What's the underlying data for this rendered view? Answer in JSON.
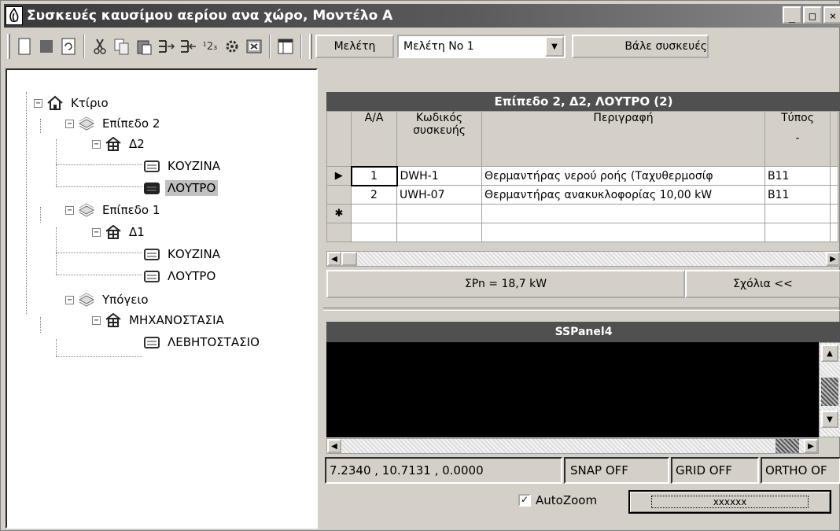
{
  "window": {
    "title": "Συσκευές καυσίμου αερίου ανα χώρο,  Μοντέλο Α",
    "min_glyph": "_",
    "max_glyph": "□",
    "close_glyph": "×"
  },
  "toolbar": {
    "study_button": "Μελέτη",
    "study_select_value": "Μελέτη No 1",
    "place_devices_button": "Βάλε συσκευές",
    "number_format_icon_text": "¹2₃",
    "icons": [
      "new-icon",
      "stop-icon",
      "refresh-icon",
      "cut-icon",
      "copy-icon",
      "paste-icon",
      "insert-right-icon",
      "insert-left-icon",
      "number-format-icon",
      "tree-gear-icon",
      "excel-icon",
      "columns-icon"
    ]
  },
  "tree": {
    "root": "Κτίριο",
    "level2": "Επίπεδο 2",
    "d2": "Δ2",
    "kitchen2": "ΚΟΥΖΙΝΑ",
    "bath2": "ΛΟΥΤΡΟ",
    "level1": "Επίπεδο 1",
    "d1": "Δ1",
    "kitchen1": "ΚΟΥΖΙΝΑ",
    "bath1": "ΛΟΥΤΡΟ",
    "basement": "Υπόγειο",
    "engine_room": "ΜΗΧΑΝΟΣΤΑΣΙΑ",
    "boiler_room": "ΛΕΒΗΤΟΣΤΑΣΙΟ"
  },
  "grid": {
    "title": "Επίπεδο 2, Δ2, ΛΟΥΤΡΟ (2)",
    "columns": {
      "aa": "Α/Α",
      "code_line1": "Κωδικός",
      "code_line2": "συσκευής",
      "description": "Περιγραφή",
      "type": "Τύπος",
      "type_unit": "-"
    },
    "rows": [
      {
        "aa": "1",
        "code": "DWH-1",
        "description": "Θερμαντήρας νερού ροής (Ταχυθερμοσίφ",
        "type": "B11"
      },
      {
        "aa": "2",
        "code": "UWH-07",
        "description": "Θερμαντήρας ανακυκλοφορίας 10,00 kW",
        "type": "B11"
      }
    ],
    "current_row_marker": "▶",
    "new_row_marker": "✱",
    "total_power": "ΣPn = 18,7 kW",
    "comments_button": "Σχόλια <<"
  },
  "lower_panel": {
    "title": "SSPanel4",
    "coordinates": "7.2340 , 10.7131 , 0.0000",
    "snap": "SNAP OFF",
    "grid": "GRID OFF",
    "ortho": "ORTHO OF",
    "autozoom_label": "AutoZoom",
    "autozoom_checked": true,
    "autozoom_check_glyph": "✓",
    "action_button": "xxxxxx"
  }
}
